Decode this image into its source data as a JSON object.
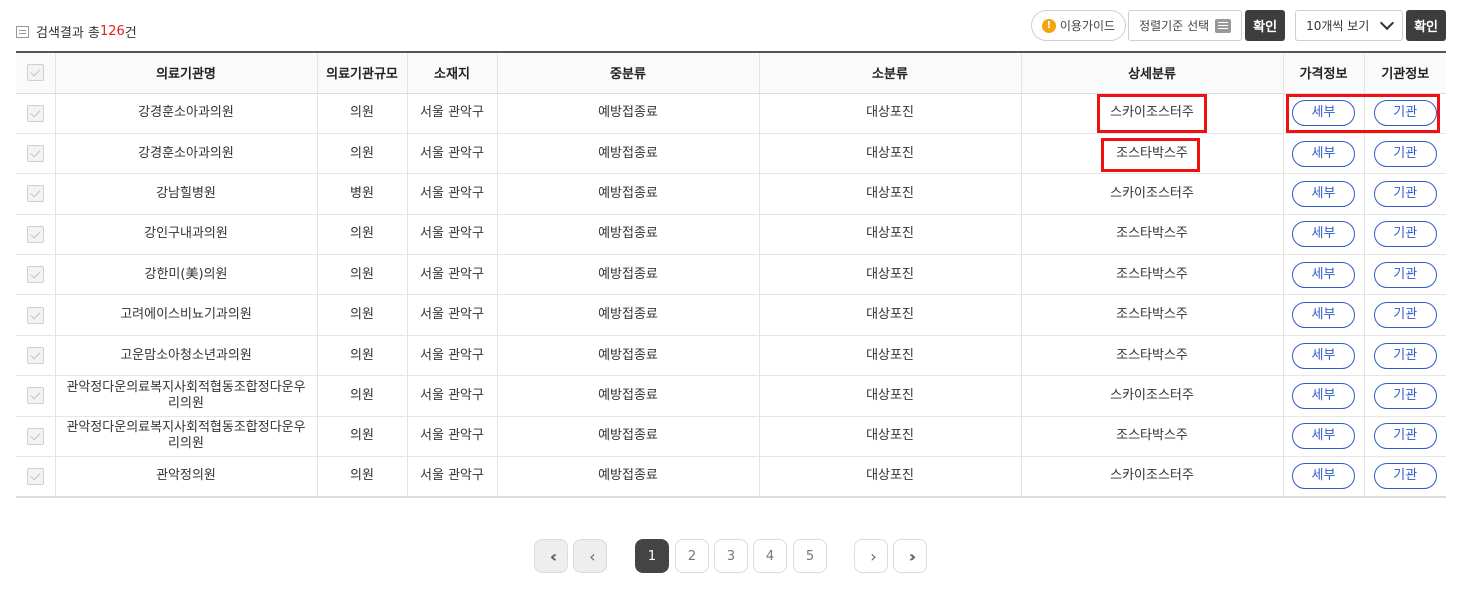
{
  "header": {
    "result_prefix": "검색결과 총",
    "result_count": "126",
    "result_suffix": "건",
    "guide_label": "이용가이드",
    "sort_label": "정렬기준 선택",
    "confirm_label": "확인",
    "per_page_value": "10개씩 보기",
    "confirm2_label": "확인"
  },
  "table": {
    "columns": [
      "의료기관명",
      "의료기관규모",
      "소재지",
      "중분류",
      "소분류",
      "상세분류",
      "가격정보",
      "기관정보"
    ],
    "detail_label": "세부",
    "org_label": "기관",
    "rows": [
      {
        "name": "강경훈소아과의원",
        "size": "의원",
        "location": "서울 관악구",
        "mid": "예방접종료",
        "small": "대상포진",
        "detail": "스카이조스터주"
      },
      {
        "name": "강경훈소아과의원",
        "size": "의원",
        "location": "서울 관악구",
        "mid": "예방접종료",
        "small": "대상포진",
        "detail": "조스타박스주"
      },
      {
        "name": "강남힐병원",
        "size": "병원",
        "location": "서울 관악구",
        "mid": "예방접종료",
        "small": "대상포진",
        "detail": "스카이조스터주"
      },
      {
        "name": "강인구내과의원",
        "size": "의원",
        "location": "서울 관악구",
        "mid": "예방접종료",
        "small": "대상포진",
        "detail": "조스타박스주"
      },
      {
        "name": "강한미(美)의원",
        "size": "의원",
        "location": "서울 관악구",
        "mid": "예방접종료",
        "small": "대상포진",
        "detail": "조스타박스주"
      },
      {
        "name": "고려에이스비뇨기과의원",
        "size": "의원",
        "location": "서울 관악구",
        "mid": "예방접종료",
        "small": "대상포진",
        "detail": "조스타박스주"
      },
      {
        "name": "고운맘소아청소년과의원",
        "size": "의원",
        "location": "서울 관악구",
        "mid": "예방접종료",
        "small": "대상포진",
        "detail": "조스타박스주"
      },
      {
        "name": "관악정다운의료복지사회적협동조합정다운우리의원",
        "size": "의원",
        "location": "서울 관악구",
        "mid": "예방접종료",
        "small": "대상포진",
        "detail": "스카이조스터주"
      },
      {
        "name": "관악정다운의료복지사회적협동조합정다운우리의원",
        "size": "의원",
        "location": "서울 관악구",
        "mid": "예방접종료",
        "small": "대상포진",
        "detail": "조스타박스주"
      },
      {
        "name": "관악정의원",
        "size": "의원",
        "location": "서울 관악구",
        "mid": "예방접종료",
        "small": "대상포진",
        "detail": "스카이조스터주"
      }
    ]
  },
  "pagination": {
    "pages": [
      "1",
      "2",
      "3",
      "4",
      "5"
    ],
    "current": "1"
  },
  "colors": {
    "highlight": "#ee1111",
    "accent_blue": "#2f5cc9",
    "count_red": "#e02020"
  }
}
